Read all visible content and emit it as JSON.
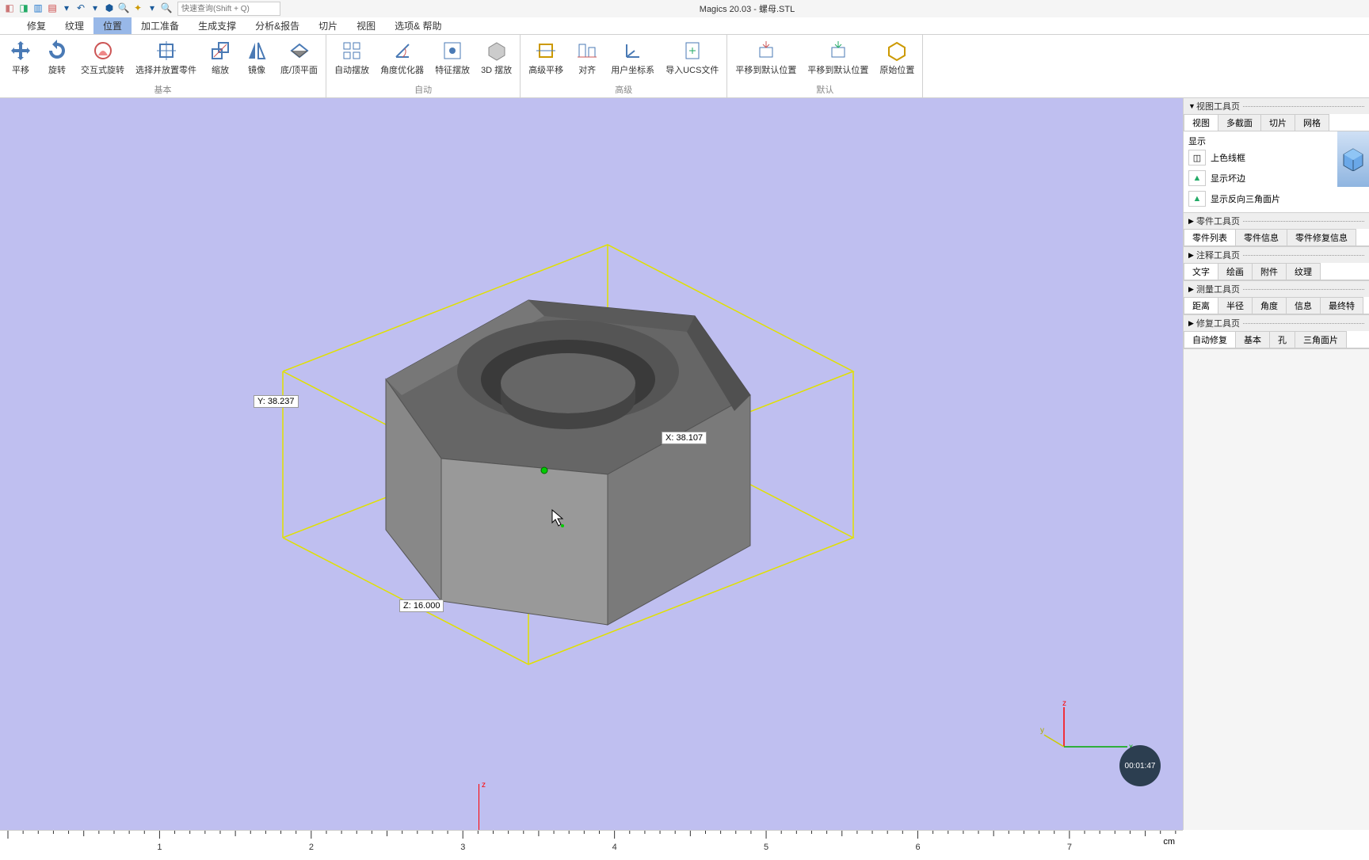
{
  "title": "Magics 20.03 - 螺母.STL",
  "search_placeholder": "快速查询(Shift + Q)",
  "menu_tabs": [
    "修复",
    "纹理",
    "位置",
    "加工准备",
    "生成支撑",
    "分析&报告",
    "切片",
    "视图",
    "选项& 帮助"
  ],
  "menu_active_index": 2,
  "ribbon": {
    "groups": [
      {
        "label": "基本",
        "buttons": [
          "平移",
          "旋转",
          "交互式旋转",
          "选择并放置零件",
          "缩放",
          "镜像",
          "底/顶平面"
        ]
      },
      {
        "label": "自动",
        "buttons": [
          "自动摆放",
          "角度优化器",
          "特征摆放",
          "3D 摆放"
        ]
      },
      {
        "label": "高级",
        "buttons": [
          "高级平移",
          "对齐",
          "用户坐标系",
          "导入UCS文件"
        ]
      },
      {
        "label": "默认",
        "buttons": [
          "平移到默认位置",
          "平移到默认位置",
          "原始位置"
        ]
      }
    ]
  },
  "dimensions": {
    "x": "X: 38.107",
    "y": "Y: 38.237",
    "z": "Z: 16.000"
  },
  "axis_labels": {
    "x": "x",
    "y": "y",
    "z": "z"
  },
  "ruler": {
    "marker": "z",
    "unit": "cm",
    "ticks": [
      "1",
      "2",
      "3",
      "4",
      "5",
      "6",
      "7"
    ]
  },
  "timer": "00:01:47",
  "side": {
    "view_tools": {
      "title": "视图工具页",
      "tabs": [
        "视图",
        "多截面",
        "切片",
        "网格"
      ],
      "active": 0,
      "display_label": "显示",
      "items": [
        "上色线框",
        "显示坏边",
        "显示反向三角面片"
      ]
    },
    "part_tools": {
      "title": "零件工具页",
      "tabs": [
        "零件列表",
        "零件信息",
        "零件修复信息"
      ],
      "active": 0
    },
    "annotation_tools": {
      "title": "注释工具页",
      "tabs": [
        "文字",
        "绘画",
        "附件",
        "纹理"
      ],
      "active": 0
    },
    "measure_tools": {
      "title": "测量工具页",
      "tabs": [
        "距离",
        "半径",
        "角度",
        "信息",
        "最终特"
      ],
      "active": 0
    },
    "repair_tools": {
      "title": "修复工具页",
      "tabs": [
        "自动修复",
        "基本",
        "孔",
        "三角面片"
      ],
      "active": 0
    }
  }
}
